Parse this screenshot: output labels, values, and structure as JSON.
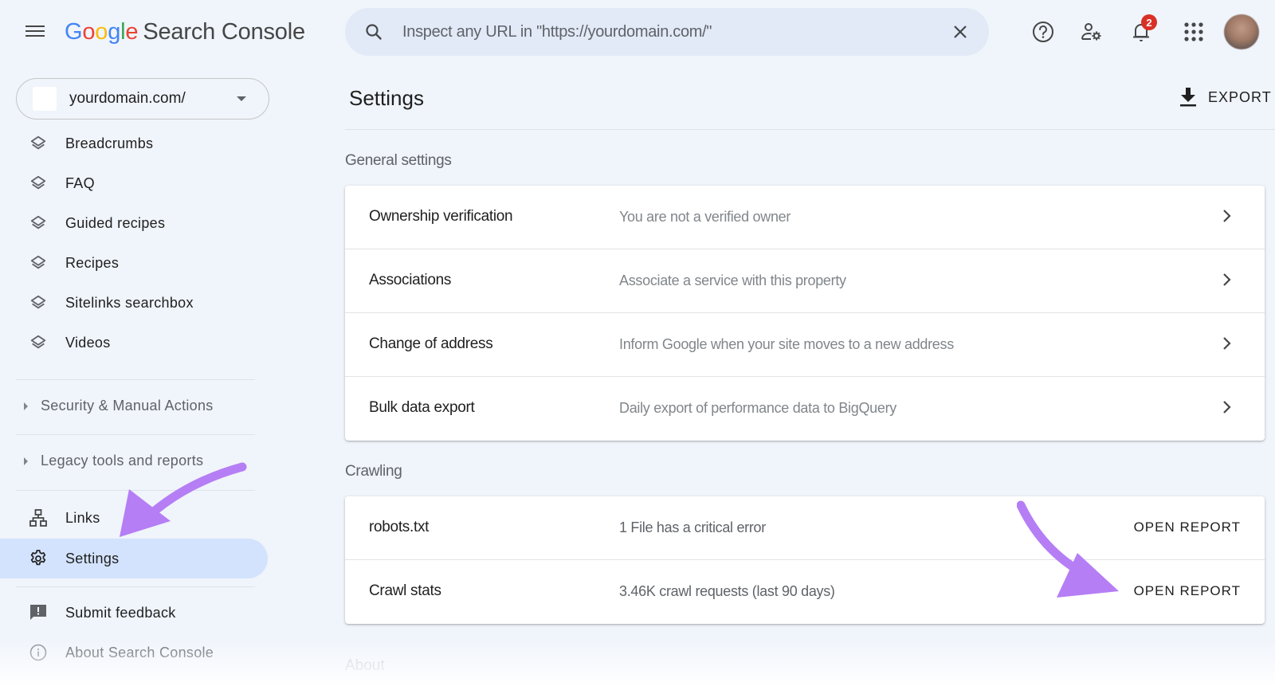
{
  "header": {
    "logo_letters": [
      "G",
      "o",
      "o",
      "g",
      "l",
      "e"
    ],
    "product_name": "Search Console",
    "search_placeholder": "Inspect any URL in \"https://yourdomain.com/\"",
    "notification_count": "2"
  },
  "property_selector": {
    "value": "yourdomain.com/"
  },
  "sidebar": {
    "enhancement_items": [
      {
        "label": "Breadcrumbs",
        "icon": "layers-icon"
      },
      {
        "label": "FAQ",
        "icon": "layers-icon"
      },
      {
        "label": "Guided recipes",
        "icon": "layers-icon"
      },
      {
        "label": "Recipes",
        "icon": "layers-icon"
      },
      {
        "label": "Sitelinks searchbox",
        "icon": "layers-icon"
      },
      {
        "label": "Videos",
        "icon": "layers-icon"
      }
    ],
    "sections": [
      {
        "label": "Security & Manual Actions"
      },
      {
        "label": "Legacy tools and reports"
      }
    ],
    "links_label": "Links",
    "settings_label": "Settings",
    "feedback_label": "Submit feedback",
    "about_label": "About Search Console"
  },
  "main": {
    "title": "Settings",
    "export_label": "EXPORT",
    "general": {
      "label": "General settings",
      "rows": [
        {
          "name": "Ownership verification",
          "description": "You are not a verified owner"
        },
        {
          "name": "Associations",
          "description": "Associate a service with this property"
        },
        {
          "name": "Change of address",
          "description": "Inform Google when your site moves to a new address"
        },
        {
          "name": "Bulk data export",
          "description": "Daily export of performance data to BigQuery"
        }
      ]
    },
    "crawling": {
      "label": "Crawling",
      "rows": [
        {
          "name": "robots.txt",
          "description": "1 File has a critical error",
          "action": "OPEN REPORT"
        },
        {
          "name": "Crawl stats",
          "description": "3.46K crawl requests (last 90 days)",
          "action": "OPEN REPORT"
        }
      ]
    },
    "about_label": "About"
  },
  "colors": {
    "background": "#f0f4fb",
    "active_nav": "#d3e3fd",
    "annotation_arrow": "#b57ef5",
    "badge": "#d93025"
  }
}
